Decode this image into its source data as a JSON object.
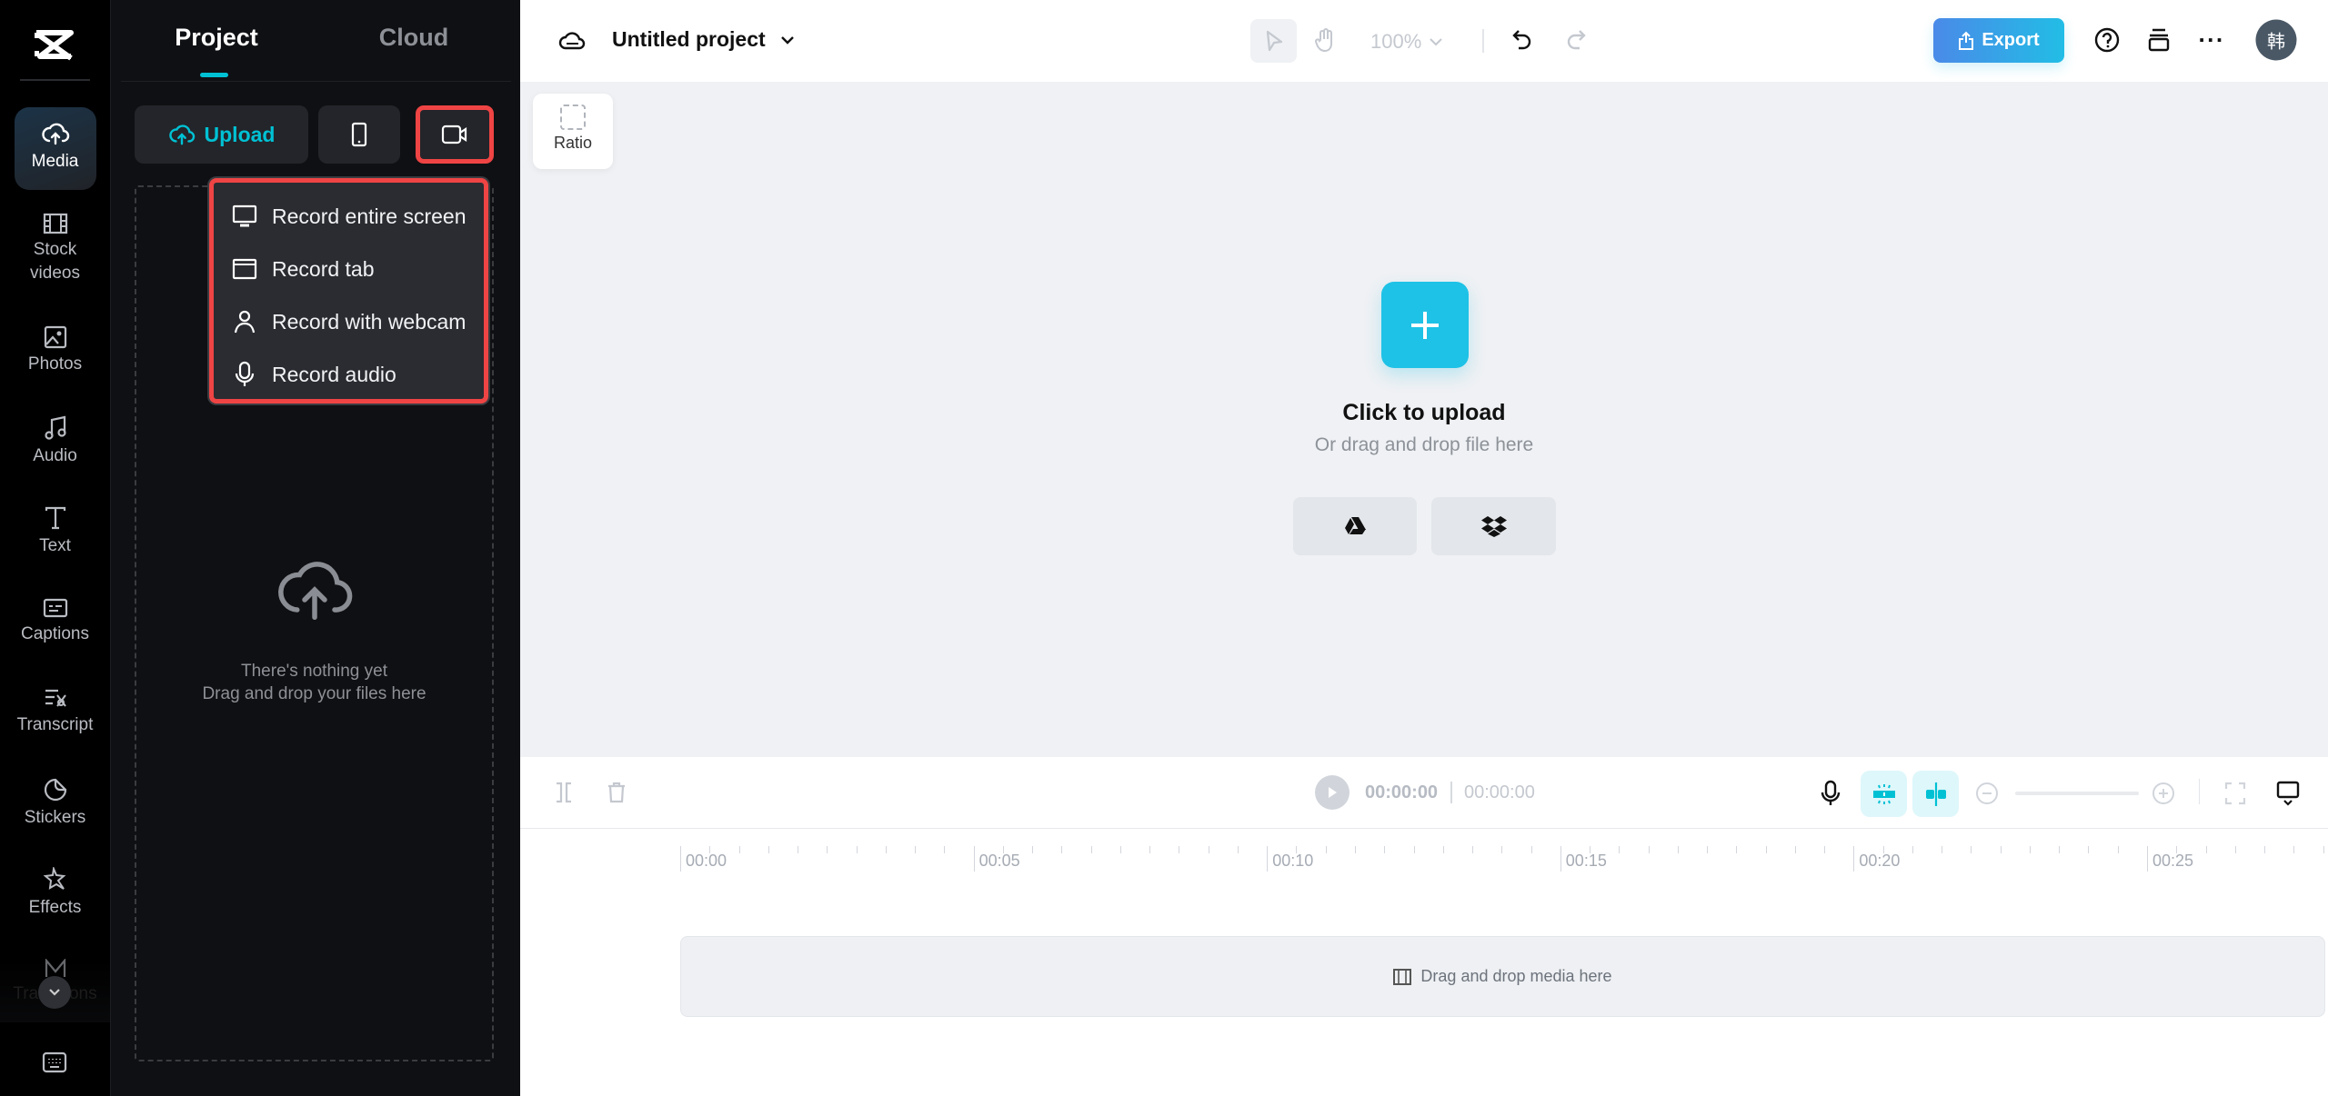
{
  "sidebar": {
    "items": [
      {
        "label": "Media",
        "icon": "cloud-upload-icon",
        "active": true
      },
      {
        "label": "Stock videos",
        "icon": "film-icon"
      },
      {
        "label": "Photos",
        "icon": "image-icon"
      },
      {
        "label": "Audio",
        "icon": "music-note-icon"
      },
      {
        "label": "Text",
        "icon": "text-icon"
      },
      {
        "label": "Captions",
        "icon": "captions-icon"
      },
      {
        "label": "Transcript",
        "icon": "transcript-icon"
      },
      {
        "label": "Stickers",
        "icon": "sticker-icon"
      },
      {
        "label": "Effects",
        "icon": "effects-star-icon"
      },
      {
        "label": "Transitions",
        "icon": "transitions-icon"
      }
    ]
  },
  "panel": {
    "tabs": [
      {
        "label": "Project",
        "active": true
      },
      {
        "label": "Cloud"
      }
    ],
    "upload_label": "Upload",
    "record_menu": [
      {
        "label": "Record entire screen",
        "icon": "monitor-icon"
      },
      {
        "label": "Record tab",
        "icon": "browser-tab-icon"
      },
      {
        "label": "Record with webcam",
        "icon": "person-icon"
      },
      {
        "label": "Record audio",
        "icon": "microphone-icon"
      }
    ],
    "empty_title": "There's nothing yet",
    "empty_sub": "Drag and drop your files here"
  },
  "header": {
    "project_name": "Untitled project",
    "zoom": "100%",
    "export_label": "Export",
    "avatar_text": "韩"
  },
  "canvas": {
    "ratio_label": "Ratio",
    "upload_title": "Click to upload",
    "upload_sub": "Or drag and drop file here"
  },
  "timeline": {
    "current_time": "00:00:00",
    "total_time": "00:00:00",
    "ruler": [
      "00:00",
      "00:05",
      "00:10",
      "00:15",
      "00:20",
      "00:25"
    ],
    "track_hint": "Drag and drop media here"
  },
  "colors": {
    "accent": "#00c1d4",
    "highlight": "#ef4444",
    "export_start": "#4a8ae8",
    "export_end": "#22bde6"
  }
}
